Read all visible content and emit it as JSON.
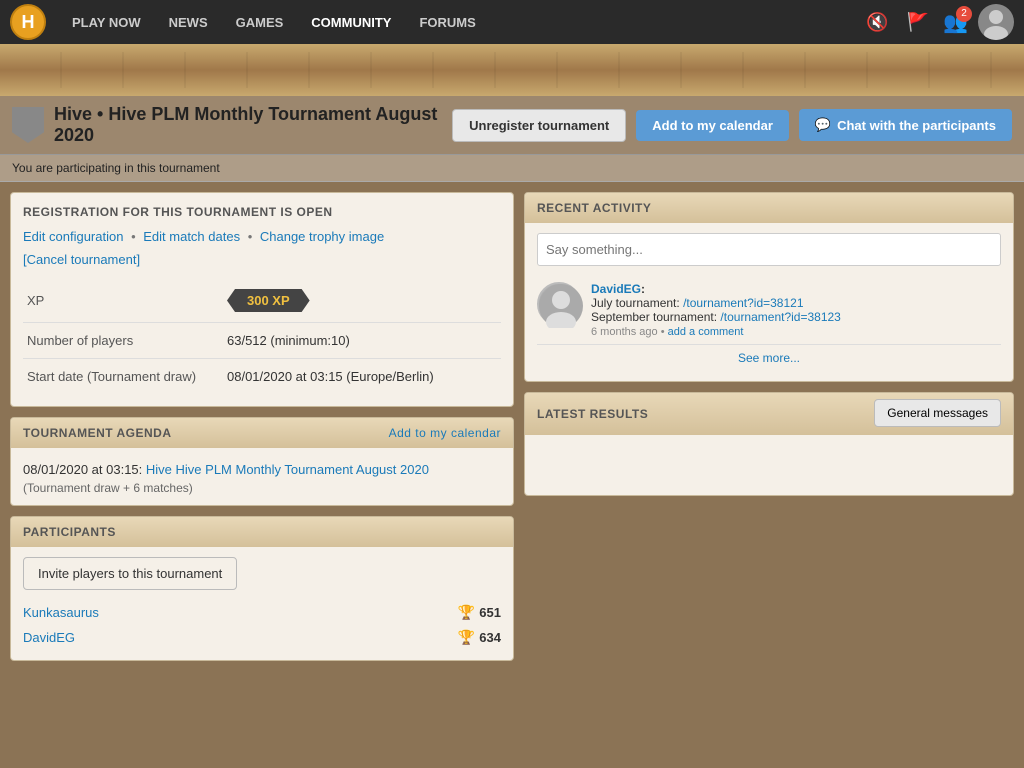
{
  "nav": {
    "links": [
      {
        "id": "play-now",
        "label": "PLAY NOW"
      },
      {
        "id": "news",
        "label": "NEWS"
      },
      {
        "id": "games",
        "label": "GAMES"
      },
      {
        "id": "community",
        "label": "COMMUNITY"
      },
      {
        "id": "forums",
        "label": "FORUMS"
      }
    ],
    "badge_count": "2"
  },
  "header": {
    "title": "Hive • Hive PLM Monthly Tournament August 2020",
    "btn_unregister": "Unregister tournament",
    "btn_calendar": "Add to my calendar",
    "btn_chat": "Chat with the participants",
    "status_text": "You are participating in this tournament"
  },
  "registration": {
    "title": "REGISTRATION FOR THIS TOURNAMENT IS OPEN",
    "edit_config": "Edit configuration",
    "edit_matches": "Edit match dates",
    "change_trophy": "Change trophy image",
    "cancel_tournament": "[Cancel tournament]",
    "xp_label": "XP",
    "xp_value": "300 XP",
    "players_label": "Number of players",
    "players_value": "63/512 (minimum:10)",
    "start_label": "Start date (Tournament draw)",
    "start_value": "08/01/2020 at 03:15 (Europe/Berlin)"
  },
  "agenda": {
    "title": "TOURNAMENT AGENDA",
    "add_calendar": "Add to my calendar",
    "event_time": "08/01/2020 at 03:15:",
    "event_link": "Hive Hive PLM Monthly Tournament August 2020",
    "event_sub": "(Tournament draw + 6 matches)"
  },
  "participants": {
    "title": "PARTICIPANTS",
    "invite_btn": "Invite players to this tournament",
    "list": [
      {
        "name": "Kunkasaurus",
        "xp": "651"
      },
      {
        "name": "DavidEG",
        "xp": "634"
      }
    ]
  },
  "recent_activity": {
    "title": "RECENT ACTIVITY",
    "say_placeholder": "Say something...",
    "user": "DavidEG",
    "activity_line1": "July tournament:",
    "link1_text": "/tournament?id=38121",
    "activity_line2": "September tournament:",
    "link2_text": "/tournament?id=38123",
    "meta_time": "6 months ago",
    "meta_sep": "•",
    "add_comment": "add a comment",
    "see_more": "See more..."
  },
  "latest_results": {
    "title": "LATEST RESULTS",
    "general_messages_btn": "General messages"
  }
}
